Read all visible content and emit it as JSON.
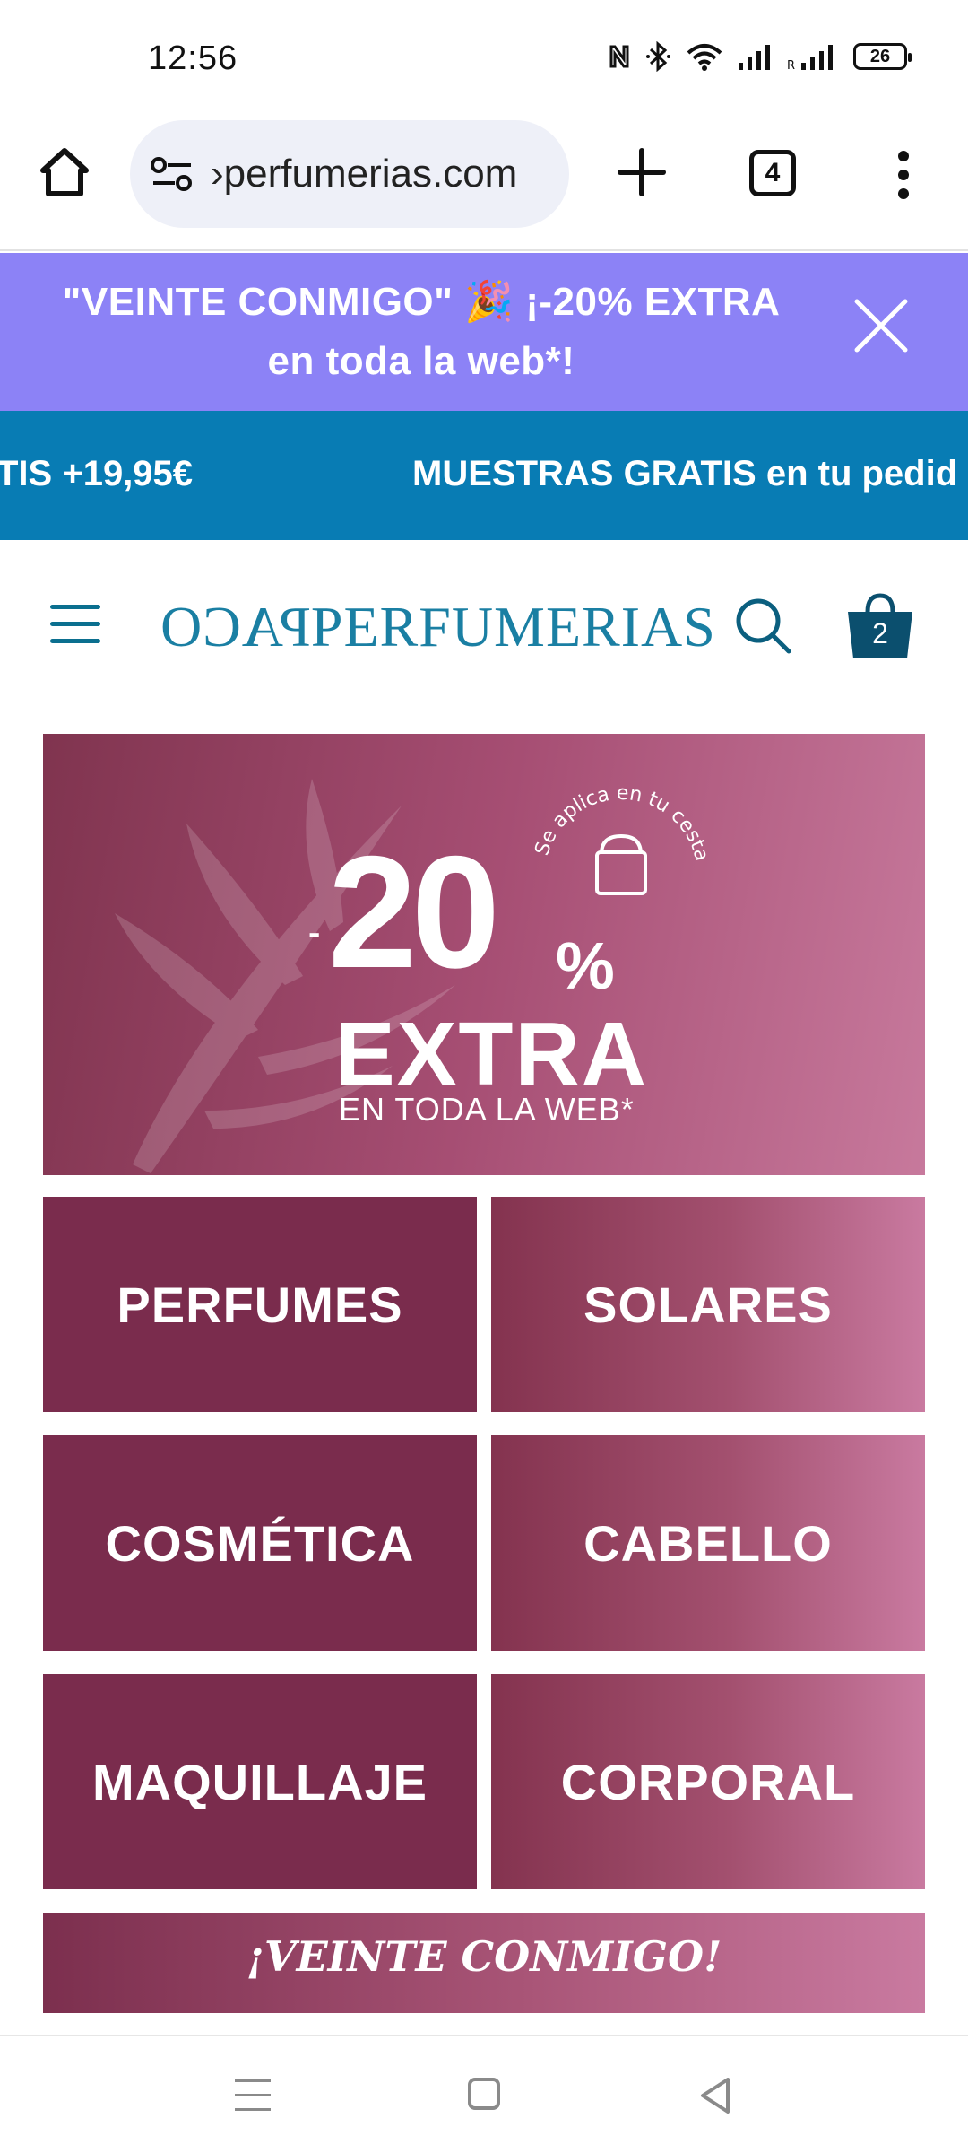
{
  "status_bar": {
    "time": "12:56",
    "battery": "26",
    "icons": [
      "nfc-icon",
      "bluetooth-icon",
      "wifi-icon",
      "signal-icon",
      "roaming-signal-icon",
      "battery-icon"
    ]
  },
  "browser": {
    "url": "›perfumerias.com",
    "tab_count": "4",
    "icons": [
      "home-icon",
      "site-settings-icon",
      "plus-icon",
      "tabs-icon",
      "more-vert-icon"
    ]
  },
  "promo": {
    "text": "\"VEINTE CONMIGO\" 🎉 ¡-20% EXTRA en toda la web*!",
    "close_icon": "close-icon",
    "background": "#8c82f6"
  },
  "ticker": {
    "segment_left": "TIS +19,95€",
    "segment_right": "MUESTRAS GRATIS en tu pedid",
    "background": "#087cb4"
  },
  "header": {
    "logo_mirrored": "PACO",
    "logo_text": "PERFUMERIAS",
    "cart_count": "2",
    "brand_color": "#1a7fa3"
  },
  "hero": {
    "seal_text": "Se aplica en tu cesta",
    "minus": "-",
    "percent_number": "20",
    "percent_sign": "%",
    "headline": "EXTRA",
    "subline": "EN TODA LA WEB*"
  },
  "categories": [
    {
      "label": "PERFUMES"
    },
    {
      "label": "SOLARES"
    },
    {
      "label": "COSMÉTICA"
    },
    {
      "label": "CABELLO"
    },
    {
      "label": "MAQUILLAJE"
    },
    {
      "label": "CORPORAL"
    }
  ],
  "bottom_banner": {
    "text": "¡VEINTE CONMIGO!"
  },
  "nav": {
    "icons": [
      "recents-icon",
      "home-icon",
      "back-icon"
    ]
  }
}
